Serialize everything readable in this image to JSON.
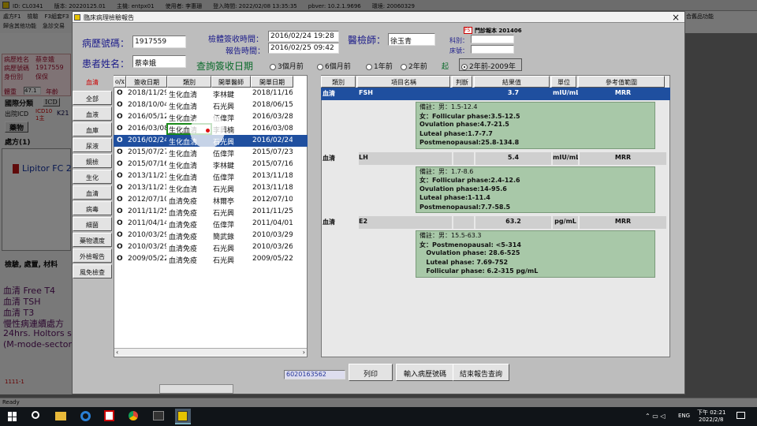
{
  "background": {
    "titlebar_items": [
      "ID: CL0341",
      "版本: 20220125.01",
      "主機: entpx01",
      "使用者: 李惠珊",
      "登入時間: 2022/02/08 13:35:35",
      "pbver: 10.2.1.9696",
      "環境: 20060329"
    ],
    "menu_items": [
      "處方F1",
      "檢驗",
      "F3組套F3"
    ],
    "menu_row2": [
      "歸含其他功能",
      "急診交易"
    ],
    "right_menu": "合舊品功能",
    "patient_rows": [
      "病歷姓名",
      "病歷號碼",
      "身份別"
    ],
    "patient_vals": [
      "蔡幸娥",
      "1917559",
      "保保"
    ],
    "weight_label": "體重",
    "weight_val": "47.1",
    "age_label": "年齡",
    "left_labels": [
      "國際分類",
      "出院ICD",
      "藥物",
      "處方(1)"
    ],
    "icd_label": "ICD",
    "icd10_label": "ICD10",
    "icd10_sub": "1主",
    "k21": "K21",
    "drug_item": "Lipitor FC 2",
    "exam_header": "檢驗, 處置, 材料",
    "exam_items": [
      "血清 Free T4",
      "血清 TSH",
      "血清 T3",
      "慢性病連續處方",
      "24hrs. Holtors sc",
      "(M-mode-sector-"
    ],
    "footer_code": "1111-1",
    "status": "Ready"
  },
  "window": {
    "title": "臨床病理檢驗報告",
    "close": "×",
    "chart_no_label": "病歷號碼：",
    "chart_no": "1917559",
    "name_label": "患者姓名：",
    "name": "蔡幸娥",
    "recv_time_label": "檢體簽收時間：",
    "recv_time": "2016/02/24 19:28",
    "report_time_label": "報告時間：",
    "report_time": "2016/02/25 09:42",
    "doctor_label": "醫檢師：",
    "doctor": "徐玉青",
    "badge": "門診報本 201406",
    "badge_icon": "FS",
    "dept_label": "科別：",
    "bed_label": "床號：",
    "query_label": "查詢簽收日期",
    "radio_options": [
      "3個月前",
      "6個月前",
      "1年前",
      "2年前"
    ],
    "from_label": "起",
    "range_option": "2年前-2009年"
  },
  "categories": [
    "血清",
    "全部",
    "血液",
    "血庫",
    "尿液",
    "鏡檢",
    "生化",
    "血清",
    "病毒",
    "細菌",
    "藥物濃度",
    "外檢報告",
    "風免檢查"
  ],
  "list": {
    "headers": [
      "o/x",
      "簽收日期",
      "類別",
      "開單醫師",
      "開單日期"
    ],
    "rows": [
      [
        "O",
        "2018/11/29",
        "生化血清",
        "李林鍵",
        "2018/11/16"
      ],
      [
        "O",
        "2018/10/04",
        "生化血清",
        "石光興",
        "2018/06/15"
      ],
      [
        "O",
        "2016/05/12",
        "生化血清",
        "伍偉萍",
        "2016/03/28"
      ],
      [
        "O",
        "2016/03/08",
        "生化血清",
        "李興楠",
        "2016/03/08"
      ],
      [
        "O",
        "2016/02/24",
        "生化血清",
        "石光興",
        "2016/02/24"
      ],
      [
        "O",
        "2015/07/27",
        "生化血清",
        "伍偉萍",
        "2015/07/23"
      ],
      [
        "O",
        "2015/07/16",
        "生化血清",
        "李林鍵",
        "2015/07/16"
      ],
      [
        "O",
        "2013/11/21",
        "生化血清",
        "伍偉萍",
        "2013/11/18"
      ],
      [
        "O",
        "2013/11/21",
        "生化血清",
        "石光興",
        "2013/11/18"
      ],
      [
        "O",
        "2012/07/10",
        "血清免疫",
        "林爾亭",
        "2012/07/10"
      ],
      [
        "O",
        "2011/11/25",
        "血清免疫",
        "石光興",
        "2011/11/25"
      ],
      [
        "O",
        "2011/04/14",
        "血清免疫",
        "伍偉萍",
        "2011/04/01"
      ],
      [
        "O",
        "2010/03/29",
        "血清免疫",
        "簡武錄",
        "2010/03/29"
      ],
      [
        "O",
        "2010/03/29",
        "血清免疫",
        "石光興",
        "2010/03/26"
      ],
      [
        "O",
        "2009/05/22",
        "血清免疫",
        "石光興",
        "2009/05/22"
      ]
    ],
    "selected_index": 4
  },
  "results": {
    "headers": [
      "類別",
      "項目名稱",
      "判斷",
      "結果值",
      "單位",
      "參考值範圍"
    ],
    "items": [
      {
        "cat": "血清",
        "name": "FSH",
        "flag": "",
        "value": "3.7",
        "unit": "mIU/mL",
        "ref": "MRR",
        "notes": [
          "備註：男：1.5-12.4",
          "女：Follicular phase:3.5-12.5",
          "Ovulation phase:4.7-21.5",
          "Luteal phase:1.7-7.7",
          "Postmenopausal:25.8-134.8"
        ]
      },
      {
        "cat": "血清",
        "name": "LH",
        "flag": "",
        "value": "5.4",
        "unit": "mIU/mL",
        "ref": "MRR",
        "notes": [
          "備註：男：1.7-8.6",
          "女：Follicular phase:2.4-12.6",
          "Ovulation phase:14-95.6",
          "Luteal phase:1-11.4",
          "Postmenopausal:7.7-58.5"
        ]
      },
      {
        "cat": "血清",
        "name": "E2",
        "flag": "",
        "value": "63.2",
        "unit": "pg/mL",
        "ref": "MRR",
        "notes": [
          "備註：男：15.5-63.3",
          "女：Postmenopausal: <5-314",
          "   Ovulation phase: 28.6-525",
          "   Luteal phase: 7.69-752",
          "   Follicular phase: 6.2-315 pg/mL"
        ]
      }
    ]
  },
  "footer": {
    "code": "6020163562",
    "print": "列印",
    "enter_chart": "輸入病歷號碼",
    "end_query": "結束報告查詢"
  },
  "taskbar": {
    "lang": "ENG",
    "time": "下午 02:21",
    "date": "2022/2/8"
  }
}
